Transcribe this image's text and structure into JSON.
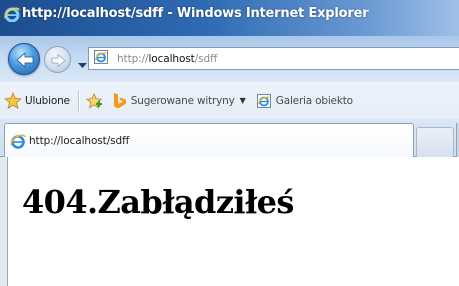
{
  "window": {
    "title": "http://localhost/sdff - Windows Internet Explorer"
  },
  "navbar": {
    "back_icon": "back-arrow-icon",
    "forward_icon": "forward-arrow-icon",
    "address": {
      "scheme": "http://",
      "host": "localhost",
      "path": "/sdff"
    }
  },
  "favorites_bar": {
    "favorites_label": "Ulubione",
    "suggested_sites_label": "Sugerowane witryny",
    "gallery_label": "Galeria obiekto"
  },
  "tab": {
    "label": "http://localhost/sdff"
  },
  "page": {
    "heading": "404.Zabłądziłeś"
  },
  "colors": {
    "titlebar": "#2f6bb3",
    "nav_background": "#c7dcf3",
    "tab_border": "#8aa0bb"
  }
}
